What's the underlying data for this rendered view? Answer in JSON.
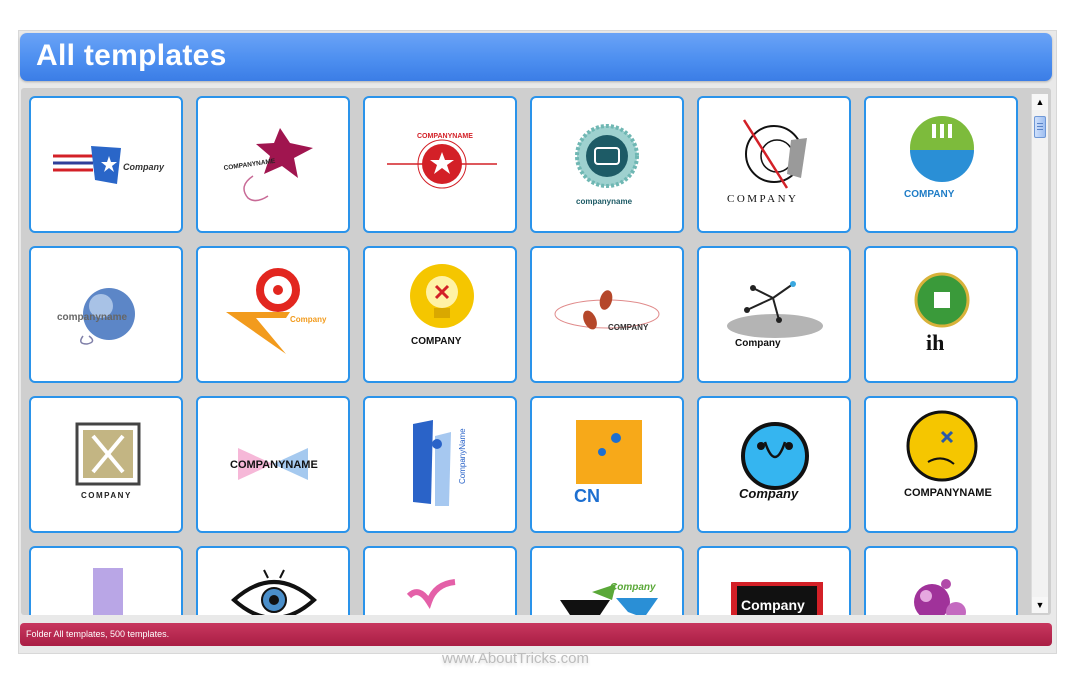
{
  "window": {
    "title": "All templates"
  },
  "status_bar": {
    "text": "Folder All templates, 500 templates."
  },
  "watermark": "www.AboutTricks.com",
  "colors": {
    "header_blue": "#4d8ff0",
    "tile_border": "#2a93ea",
    "status_red": "#b52a50"
  },
  "templates": [
    {
      "icon": "flag-star-logo",
      "text": "Company"
    },
    {
      "icon": "magenta-star-logo",
      "text": "COMPANYNAME"
    },
    {
      "icon": "star-seal-logo",
      "text": "COMPANYNAME"
    },
    {
      "icon": "gear-badge-logo",
      "text": "companyname"
    },
    {
      "icon": "circle-slash-logo",
      "text": "COMPANY"
    },
    {
      "icon": "green-globe-logo",
      "text": "COMPANY"
    },
    {
      "icon": "sphere-swirl-logo",
      "text": "companyname"
    },
    {
      "icon": "red-ring-pen-logo",
      "text": "Company"
    },
    {
      "icon": "lightbulb-logo",
      "text": "COMPANY"
    },
    {
      "icon": "footprints-logo",
      "text": "COMPANY"
    },
    {
      "icon": "molecule-logo",
      "text": "Company"
    },
    {
      "icon": "green-circle-ih-logo",
      "text": "ih"
    },
    {
      "icon": "framed-x-logo",
      "text": "COMPANY"
    },
    {
      "icon": "crystal-wings-logo",
      "text": "COMPANYNAME"
    },
    {
      "icon": "blue-blocks-logo",
      "text": "CompanyName"
    },
    {
      "icon": "cn-square-logo",
      "text": "CN"
    },
    {
      "icon": "blue-circle-logo",
      "text": "Company"
    },
    {
      "icon": "yellow-face-logo",
      "text": "COMPANYNAME"
    },
    {
      "icon": "lavender-bar-logo",
      "text": ""
    },
    {
      "icon": "eye-logo",
      "text": ""
    },
    {
      "icon": "pink-ribbon-logo",
      "text": ""
    },
    {
      "icon": "green-chevron-logo",
      "text": "Company"
    },
    {
      "icon": "black-red-block-logo",
      "text": "Company"
    },
    {
      "icon": "purple-bubbles-logo",
      "text": ""
    }
  ]
}
